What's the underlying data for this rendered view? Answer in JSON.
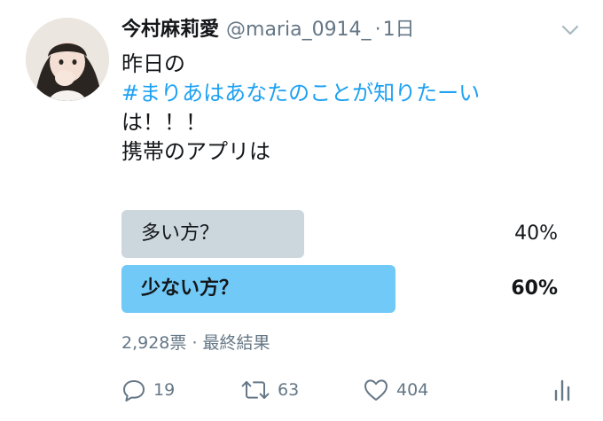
{
  "user": {
    "display_name": "今村麻莉愛",
    "handle": "@maria_0914_",
    "separator": "·",
    "time": "1日"
  },
  "tweet": {
    "line1": "昨日の",
    "hashtag": "#まりあはあなたのことが知りたーい",
    "line3": "は！！！",
    "line4": "携帯のアプリは"
  },
  "poll": {
    "options": [
      {
        "label": "多い方？",
        "percent_text": "40%",
        "percent": 40,
        "bar_color": "#ccd6dd",
        "winner": false
      },
      {
        "label": "少ない方？",
        "percent_text": "60%",
        "percent": 60,
        "bar_color": "#71c9f8",
        "winner": true
      }
    ],
    "votes": "2,928票",
    "status": "最終結果",
    "meta_separator": "·"
  },
  "actions": {
    "reply_count": "19",
    "retweet_count": "63",
    "like_count": "404"
  },
  "colors": {
    "link": "#1da1f2",
    "muted": "#657786"
  },
  "icons": {
    "avatar": "profile-photo",
    "caret": "chevron-down-icon",
    "reply": "reply-icon",
    "retweet": "retweet-icon",
    "like": "heart-icon",
    "analytics": "analytics-icon"
  }
}
